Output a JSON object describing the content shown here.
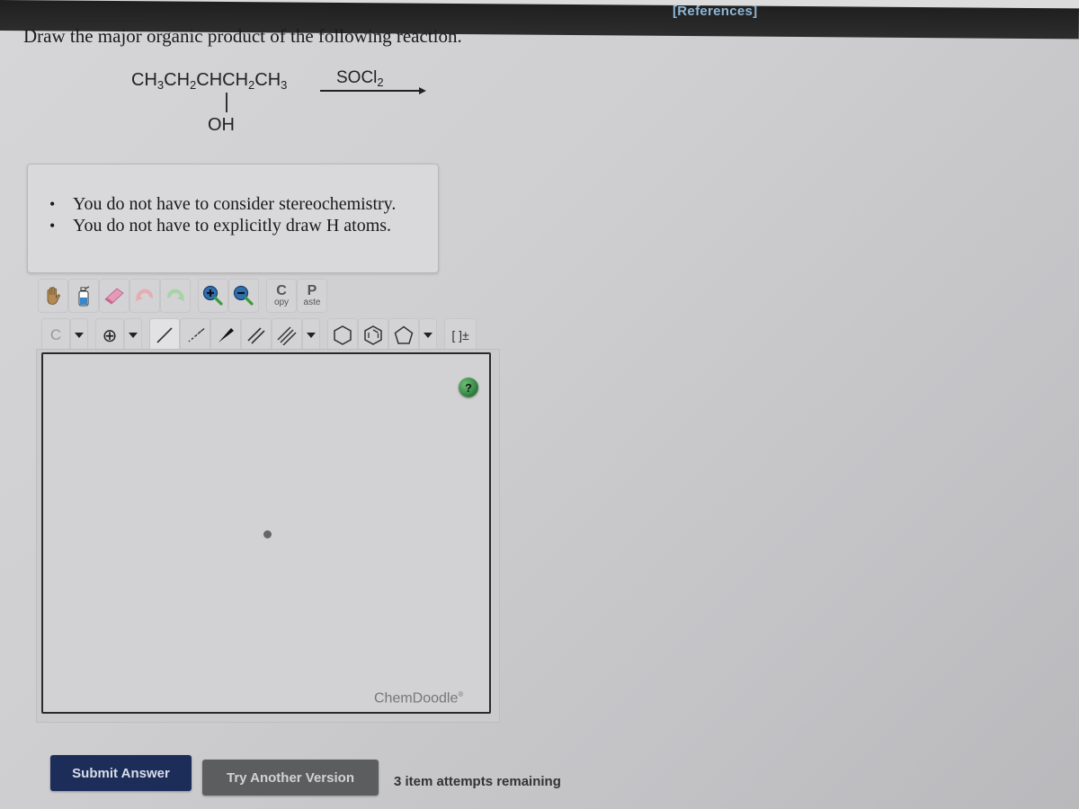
{
  "header": {
    "references_label": "[References]"
  },
  "question": {
    "prompt": "Draw the major organic product of the following reaction.",
    "reactant": {
      "parts": [
        "CH",
        "3",
        "CH",
        "2",
        "CHCH",
        "2",
        "CH",
        "3"
      ],
      "substituent": "OH"
    },
    "reagent": {
      "base": "SOCl",
      "sub": "2"
    }
  },
  "hints": [
    "You do not have to consider stereochemistry.",
    "You do not have to explicitly draw H atoms."
  ],
  "toolbar": {
    "row1": [
      {
        "name": "hand-tool",
        "icon": "hand-icon"
      },
      {
        "name": "clear-tool",
        "icon": "spray-bottle-icon"
      },
      {
        "name": "eraser-tool",
        "icon": "eraser-icon"
      },
      {
        "name": "undo",
        "icon": "undo-icon"
      },
      {
        "name": "redo",
        "icon": "redo-icon"
      },
      {
        "name": "zoom-in",
        "icon": "zoom-in-icon"
      },
      {
        "name": "zoom-out",
        "icon": "zoom-out-icon"
      }
    ],
    "copy": {
      "big": "C",
      "small": "opy"
    },
    "paste": {
      "big": "P",
      "small": "aste"
    },
    "atom_label": "C",
    "charge_label": "⊕",
    "bracket_label": "[ ]±",
    "accent_color": "#2c7a3a"
  },
  "canvas": {
    "help_label": "?",
    "brand": "ChemDoodle",
    "brand_mark": "®"
  },
  "footer": {
    "submit_label": "Submit Answer",
    "try_another_label": "Try Another Version",
    "attempts_text": "3 item attempts remaining"
  }
}
